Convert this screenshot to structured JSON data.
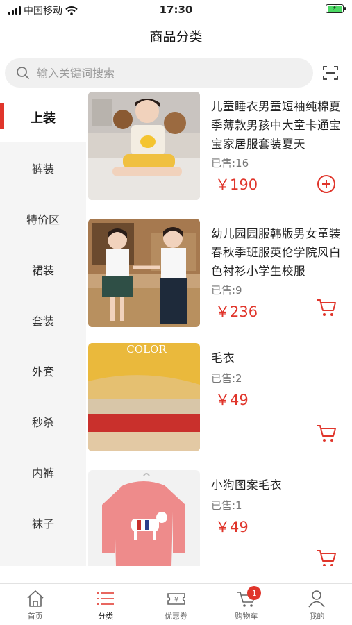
{
  "status_bar": {
    "carrier": "中国移动",
    "time": "17:30",
    "battery_icon": "battery-charging-icon"
  },
  "nav": {
    "title": "商品分类"
  },
  "search": {
    "placeholder": "输入关键词搜索",
    "icon": "search-icon",
    "scan_icon": "scan-icon"
  },
  "sidebar": {
    "items": [
      {
        "label": "上装",
        "active": true
      },
      {
        "label": "裤装"
      },
      {
        "label": "特价区"
      },
      {
        "label": "裙装"
      },
      {
        "label": "套装"
      },
      {
        "label": "外套"
      },
      {
        "label": "秒杀"
      },
      {
        "label": "内裤"
      },
      {
        "label": "袜子"
      }
    ]
  },
  "products": [
    {
      "name": "儿童睡衣男童短袖纯棉夏季薄款男孩中大童卡通宝宝家居服套装夏天",
      "sold": "已售:16",
      "price": "￥190",
      "action_icon": "add-circle-icon"
    },
    {
      "name": "幼儿园园服韩版男女童装春秋季班服英伦学院风白色衬衫小学生校服",
      "sold": "已售:9",
      "price": "￥236",
      "action_icon": "cart-icon"
    },
    {
      "name": "毛衣",
      "sold": "已售:2",
      "price": "￥49",
      "action_icon": "cart-icon",
      "image_text": "COLOR"
    },
    {
      "name": "小狗图案毛衣",
      "sold": "已售:1",
      "price": "￥49",
      "action_icon": "cart-icon"
    }
  ],
  "tab_bar": {
    "items": [
      {
        "label": "首页",
        "icon": "home-icon"
      },
      {
        "label": "分类",
        "icon": "category-list-icon",
        "active": true
      },
      {
        "label": "优惠券",
        "icon": "coupon-icon"
      },
      {
        "label": "购物车",
        "icon": "cart-icon",
        "badge": "1"
      },
      {
        "label": "我的",
        "icon": "user-icon"
      }
    ]
  },
  "colors": {
    "accent": "#e0352b",
    "sidebar_bg": "#f5f5f5",
    "search_bg": "#f0f0f0"
  }
}
